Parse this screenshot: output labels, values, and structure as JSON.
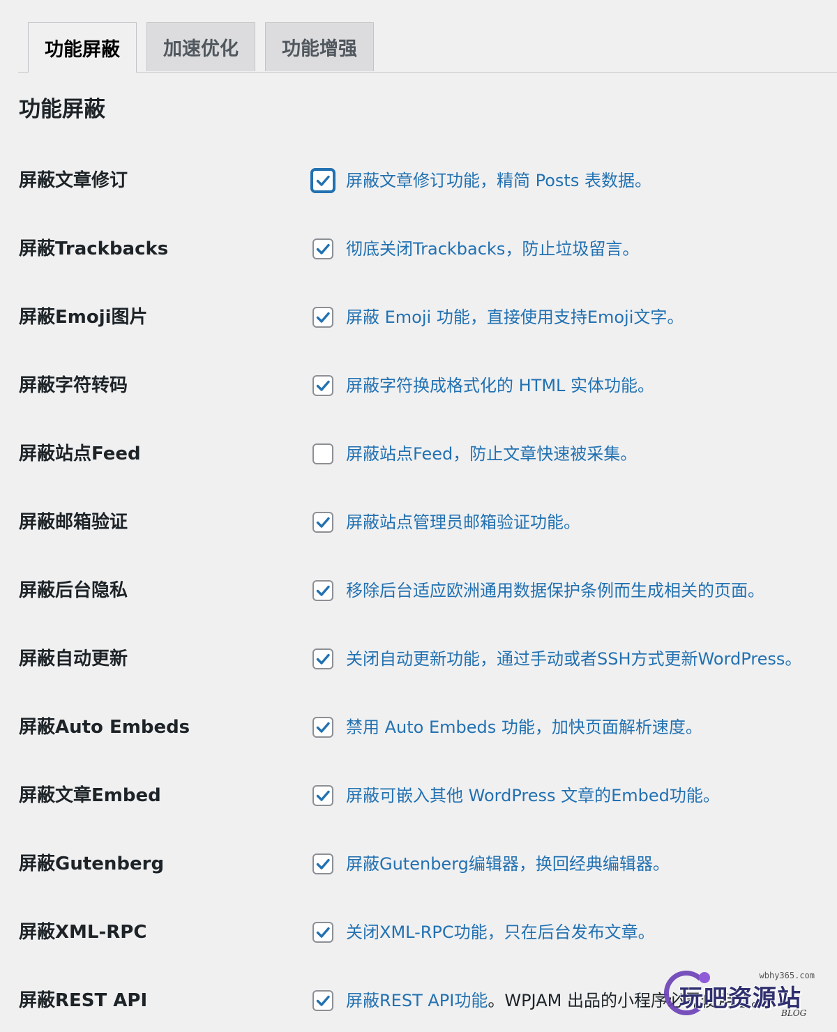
{
  "tabs": [
    {
      "label": "功能屏蔽",
      "active": true
    },
    {
      "label": "加速优化",
      "active": false
    },
    {
      "label": "功能增强",
      "active": false
    }
  ],
  "section_title": "功能屏蔽",
  "colors": {
    "link": "#2271b1",
    "text": "#1d2327",
    "background": "#f0f0f1",
    "checkbox_border": "#8c8f94"
  },
  "rows": [
    {
      "label": "屏蔽文章修订",
      "checked": true,
      "focused": true,
      "description": "屏蔽文章修订功能，精简 Posts 表数据。",
      "description_rest": ""
    },
    {
      "label": "屏蔽Trackbacks",
      "checked": true,
      "focused": false,
      "description": "彻底关闭Trackbacks，防止垃圾留言。",
      "description_rest": ""
    },
    {
      "label": "屏蔽Emoji图片",
      "checked": true,
      "focused": false,
      "description": "屏蔽 Emoji 功能，直接使用支持Emoji文字。",
      "description_rest": ""
    },
    {
      "label": "屏蔽字符转码",
      "checked": true,
      "focused": false,
      "description": "屏蔽字符换成格式化的 HTML 实体功能。",
      "description_rest": ""
    },
    {
      "label": "屏蔽站点Feed",
      "checked": false,
      "focused": false,
      "description": "屏蔽站点Feed，防止文章快速被采集。",
      "description_rest": ""
    },
    {
      "label": "屏蔽邮箱验证",
      "checked": true,
      "focused": false,
      "description": "屏蔽站点管理员邮箱验证功能。",
      "description_rest": ""
    },
    {
      "label": "屏蔽后台隐私",
      "checked": true,
      "focused": false,
      "description": "移除后台适应欧洲通用数据保护条例而生成相关的页面。",
      "description_rest": ""
    },
    {
      "label": "屏蔽自动更新",
      "checked": true,
      "focused": false,
      "description": "关闭自动更新功能，通过手动或者SSH方式更新WordPress。",
      "description_rest": ""
    },
    {
      "label": "屏蔽Auto Embeds",
      "checked": true,
      "focused": false,
      "description": "禁用 Auto Embeds 功能，加快页面解析速度。",
      "description_rest": ""
    },
    {
      "label": "屏蔽文章Embed",
      "checked": true,
      "focused": false,
      "description": "屏蔽可嵌入其他 WordPress 文章的Embed功能。",
      "description_rest": ""
    },
    {
      "label": "屏蔽Gutenberg",
      "checked": true,
      "focused": false,
      "description": "屏蔽Gutenberg编辑器，换回经典编辑器。",
      "description_rest": ""
    },
    {
      "label": "屏蔽XML-RPC",
      "checked": true,
      "focused": false,
      "description": "关闭XML-RPC功能，只在后台发布文章。",
      "description_rest": ""
    },
    {
      "label": "屏蔽REST API",
      "checked": true,
      "focused": false,
      "description": "屏蔽REST API功能",
      "description_rest": "。WPJAM 出品的小程序必需使用它。"
    }
  ],
  "watermark": {
    "url": "wbhy365.com",
    "text": "玩吧资源站",
    "blog": "BLOG"
  }
}
